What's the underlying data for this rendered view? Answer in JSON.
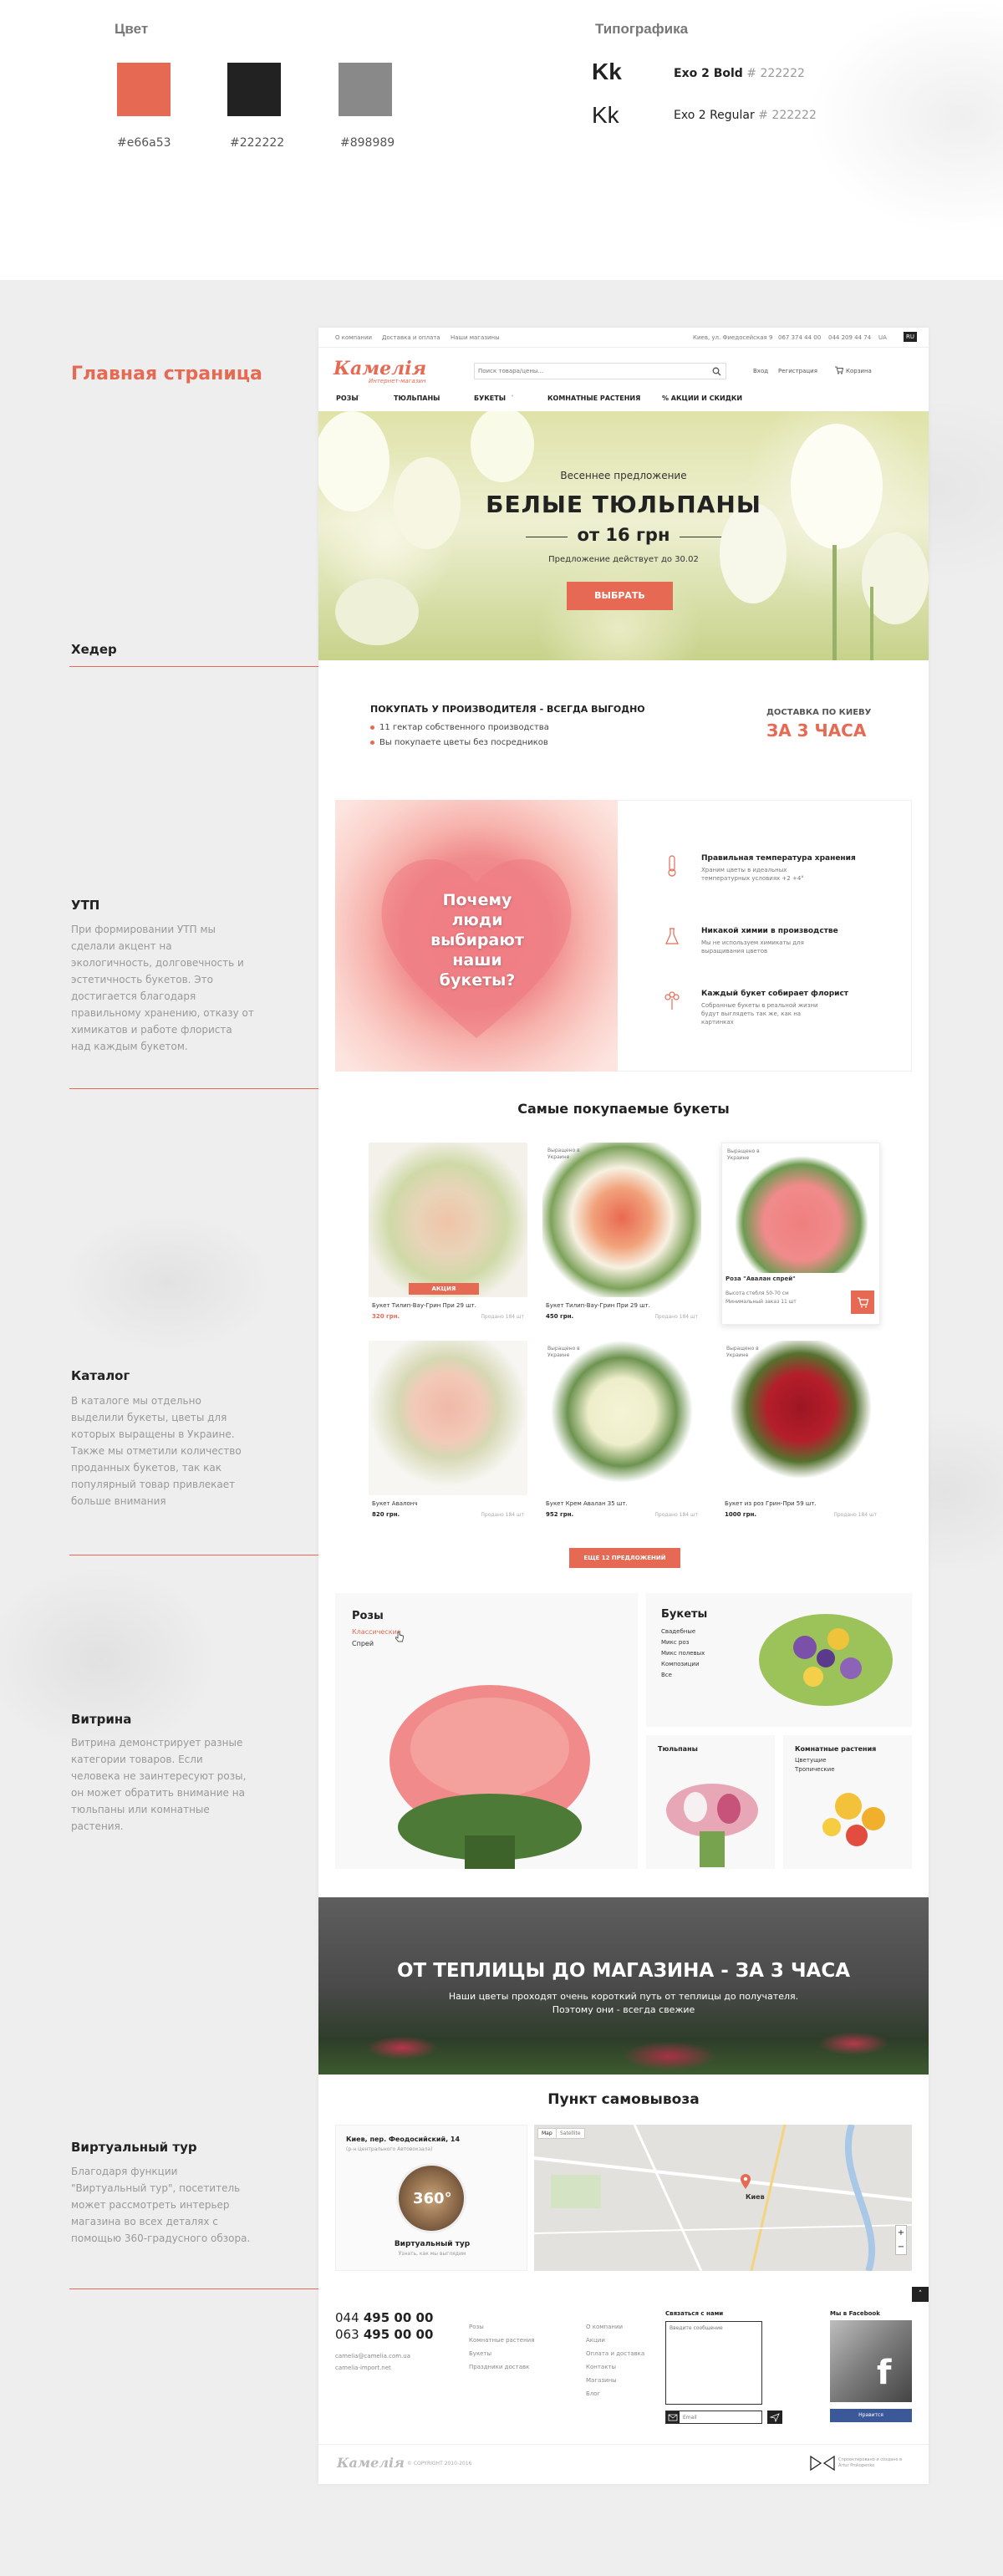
{
  "style_guide": {
    "color_title": "Цвет",
    "typography_title": "Типографика",
    "colors": [
      {
        "hex": "#e66a53",
        "label": "#e66a53"
      },
      {
        "hex": "#222222",
        "label": "#222222"
      },
      {
        "hex": "#898989",
        "label": "#898989"
      }
    ],
    "type_samples": [
      {
        "sample": "Kk",
        "font": "Exo 2 Bold",
        "color": "# 222222"
      },
      {
        "sample": "Kk",
        "font": "Exo 2 Regular",
        "color": "# 222222"
      }
    ]
  },
  "annotations": {
    "page_title": "Главная страница",
    "sections": [
      {
        "title": "Хедер",
        "text": ""
      },
      {
        "title": "УТП",
        "text": "При формировании УТП мы сделали акцент на экологичность, долговечность и эстетичность букетов. Это достигается благодаря правильному хранению, отказу от химикатов и работе флориста над каждым букетом."
      },
      {
        "title": "Каталог",
        "text": "В каталоге мы отдельно выделили букеты, цветы для которых выращены в Украине. Также мы отметили количество проданных букетов, так как популярный товар привлекает больше внимания"
      },
      {
        "title": "Витрина",
        "text": "Витрина демонстрирует разные категории товаров. Если человека не заинтересуют розы, он может обратить внимание на тюльпаны или комнатные растения."
      },
      {
        "title": "Виртуальный тур",
        "text": "Благодаря функции \"Виртуальный тур\", посетитель может рассмотреть интерьер магазина во всех деталях с помощью 360-градусного обзора."
      }
    ]
  },
  "site": {
    "topbar": {
      "links": [
        "О компании",
        "Доставка и оплата",
        "Наши магазины"
      ],
      "address": "Киев, ул. Фиедосейская 9",
      "phone1": "067 374 44 00",
      "phone2": "044 209 44 74",
      "lang": "UA",
      "lang_active": "RU"
    },
    "header": {
      "logo": "Камелія",
      "logo_sub": "Интернет-магазин",
      "search_placeholder": "Поиск товара/цены...",
      "login": "Вход",
      "register": "Регистрация",
      "cart": "Корзина"
    },
    "nav": [
      "РОЗЫ",
      "ТЮЛЬПАНЫ",
      "БУКЕТЫ",
      "КОМНАТНЫЕ РАСТЕНИЯ",
      "% АКЦИИ И СКИДКИ"
    ],
    "hero": {
      "kicker": "Весеннее предложение",
      "title": "БЕЛЫЕ ТЮЛЬПАНЫ",
      "price": "от 16 грн",
      "note": "Предложение действует до 30.02",
      "button": "ВЫБРАТЬ"
    },
    "usp": {
      "title": "ПОКУПАТЬ У ПРОИЗВОДИТЕЛЯ - ВСЕГДА ВЫГОДНО",
      "points": [
        "11 гектар собственного производства",
        "Вы покупаете цветы без посредников"
      ],
      "delivery_label": "ДОСТАВКА ПО КИЕВУ",
      "delivery_value": "ЗА 3 ЧАСА"
    },
    "why": {
      "heading": "Почему люди выбирают наши букеты?",
      "items": [
        {
          "title": "Правильная температура хранения",
          "text": "Храним цветы в идеальных температурных условиях +2 +4°"
        },
        {
          "title": "Никакой химии в производстве",
          "text": "Мы не используем химикаты для выращивания цветов"
        },
        {
          "title": "Каждый букет собирает флорист",
          "text": "Собранные букеты в реальной жизни будут выглядеть так же, как на картинках"
        }
      ]
    },
    "catalog": {
      "title": "Самые покупаемые букеты",
      "badge": "Выращено в Украине",
      "sale_tag": "АКЦИЯ",
      "products": [
        {
          "name": "Букет Тилип-Вау-Грин При 29 шт.",
          "price": "320 грн.",
          "note": "Продано 184 шт"
        },
        {
          "name": "Букет Тилип-Вау-Грин При 29 шт.",
          "price": "450 грн.",
          "note": "Продано 184 шт"
        },
        {
          "name": "Роза \"Авалан спрей\"",
          "price": "",
          "note": ""
        },
        {
          "name": "Букет Авалонч",
          "price": "820 грн.",
          "note": "Продано 184 шт"
        },
        {
          "name": "Букет Крем Авалан 35 шт.",
          "price": "952 грн.",
          "note": "Продано 184 шт"
        },
        {
          "name": "Букет из роз Грин-При 59 шт.",
          "price": "1000 грн.",
          "note": "Продано 184 шт"
        }
      ],
      "hover_lines": [
        "Высота стебля 50-70 см",
        "Минимальный заказ 11 шт"
      ],
      "more_button": "ЕЩЕ 12 ПРЕДЛОЖЕНИЙ"
    },
    "showcase": {
      "roses": {
        "title": "Розы",
        "links": [
          "Классические",
          "Спрей"
        ]
      },
      "bouquets": {
        "title": "Букеты",
        "links": [
          "Свадебные",
          "Микс роз",
          "Микс полевых",
          "Композиции",
          "Все"
        ]
      },
      "tulips": {
        "title": "Тюльпаны"
      },
      "plants": {
        "title": "Комнатные растения",
        "links": [
          "Цветущие",
          "Тропические"
        ]
      }
    },
    "greenhouse": {
      "title": "ОТ ТЕПЛИЦЫ ДО МАГАЗИНА - ЗА 3 ЧАСА",
      "text1": "Наши цветы проходят очень короткий путь от теплицы до получателя.",
      "text2": "Поэтому они - всегда свежие"
    },
    "pickup": {
      "title": "Пункт самовывоза",
      "address": "Киев, пер. Феодосийский, 14",
      "address_sub": "(р-н Центрального Автовокзала)",
      "tour_title": "Виртуальный тур",
      "tour_sub": "Узнать, как мы выглядим",
      "tour_badge": "360°",
      "map_tabs": [
        "Map",
        "Satellite"
      ],
      "map_city": "Киев"
    },
    "footer": {
      "phone1_code": "044",
      "phone1": "495 00 00",
      "phone2_code": "063",
      "phone2": "495 00 00",
      "emails": [
        "camelia@camelia.com.ua",
        "camelia-import.net"
      ],
      "col1": [
        "Розы",
        "Комнатные растения",
        "Букеты",
        "Праздники доставк"
      ],
      "col2": [
        "О компании",
        "Акции",
        "Оплата и доставка",
        "Контакты",
        "Магазины",
        "Блог"
      ],
      "contact_title": "Связаться с нами",
      "contact_placeholder": "Введите сообщение",
      "email_placeholder": "Email",
      "fb_title": "Мы в Facebook",
      "fb_button": "Нравится",
      "logo": "Камелія",
      "copyright": "© COPYRIGHT 2010-2016",
      "credit": "Спроектировано и создано в Artur Prokopenko"
    }
  }
}
